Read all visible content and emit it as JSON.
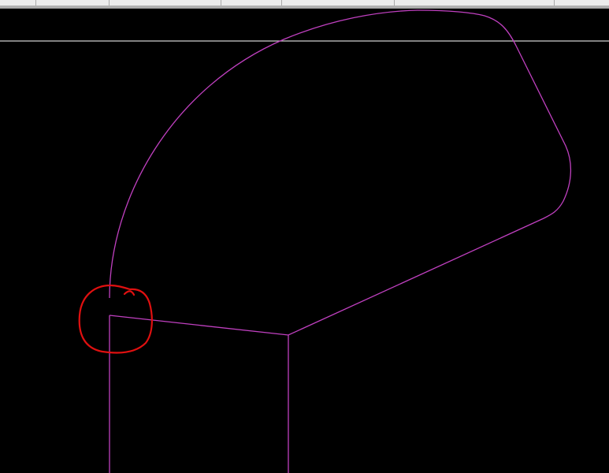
{
  "app": {
    "toolbar_cells": 6
  },
  "colors": {
    "background": "#000000",
    "geometry": "#c040c0",
    "markup": "#e01010",
    "guide": "#d0d0d0",
    "toolbar": "#ececec"
  }
}
